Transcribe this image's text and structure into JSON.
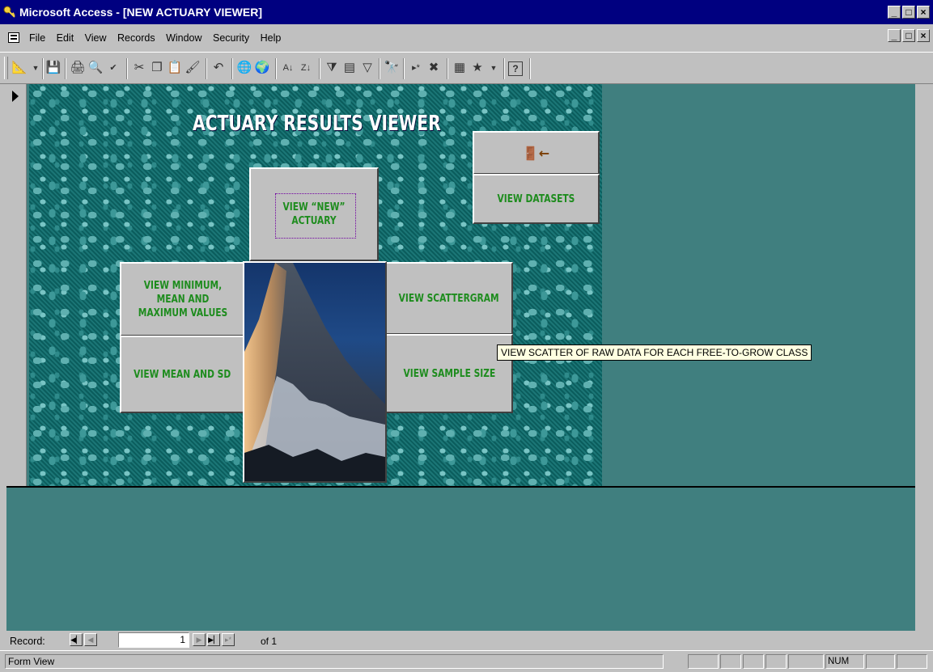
{
  "window": {
    "title": "Microsoft Access - [NEW ACTUARY VIEWER]",
    "controls": [
      "_",
      "□",
      "×"
    ]
  },
  "menubar": {
    "items": [
      "File",
      "Edit",
      "View",
      "Records",
      "Window",
      "Security",
      "Help"
    ]
  },
  "toolbar": {
    "icons": [
      "design-view-icon",
      "save-icon",
      "print-icon",
      "print-preview-icon",
      "spelling-icon",
      "cut-icon",
      "copy-icon",
      "paste-icon",
      "format-painter-icon",
      "undo-icon",
      "insert-hyperlink-icon",
      "web-toolbar-icon",
      "sort-ascending-icon",
      "sort-descending-icon",
      "filter-by-selection-icon",
      "filter-by-form-icon",
      "apply-filter-icon",
      "find-icon",
      "new-record-icon",
      "delete-record-icon",
      "database-window-icon",
      "new-object-icon",
      "help-icon"
    ]
  },
  "form": {
    "title": "ACTUARY RESULTS VIEWER",
    "buttons": {
      "view_new_actuary": "VIEW “NEW” ACTUARY",
      "exit_icon": "exit-door-icon",
      "view_datasets": "VIEW DATASETS",
      "view_min_mean_max": "VIEW MINIMUM, MEAN AND MAXIMUM VALUES",
      "view_mean_sd": "VIEW MEAN AND SD",
      "view_scattergram": "VIEW SCATTERGRAM",
      "view_sample_size": "VIEW SAMPLE SIZE"
    },
    "image": "mountain-peak-photo",
    "tooltip": "VIEW SCATTER OF RAW DATA FOR EACH FREE-TO-GROW CLASS"
  },
  "record_nav": {
    "label": "Record:",
    "current": "1",
    "of_text": "of 1"
  },
  "status": {
    "text": "Form View",
    "num": "NUM"
  },
  "colors": {
    "title_bar": "#000080",
    "mdi_bg": "#407f7f",
    "button_text": "#1e8c1e",
    "tooltip_bg": "#ffffe1"
  }
}
